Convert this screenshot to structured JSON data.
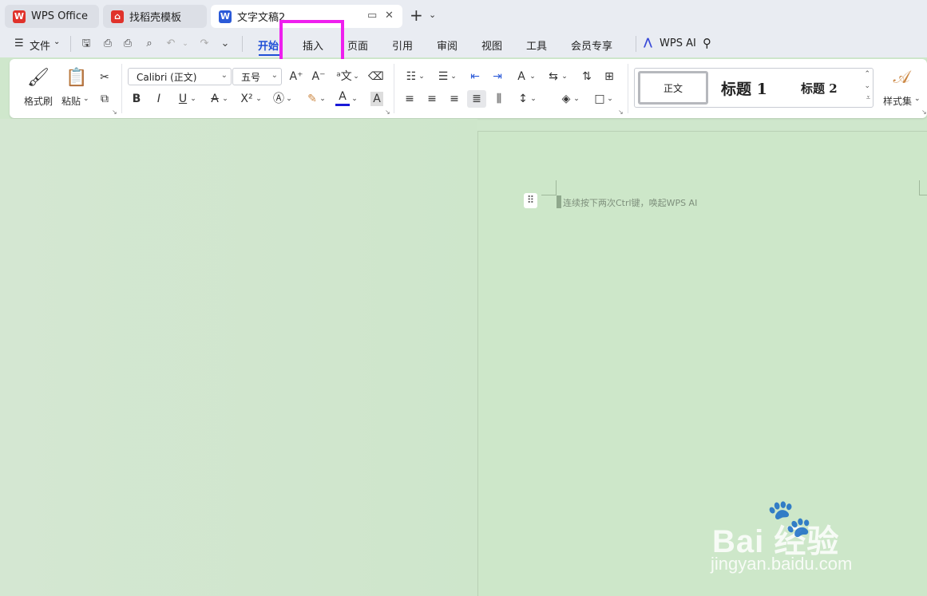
{
  "tabs": [
    {
      "label": "WPS Office",
      "icon": "wps-logo-icon",
      "color": "#e0322b"
    },
    {
      "label": "找稻壳模板",
      "icon": "docer-logo-icon",
      "color": "#e0322b"
    },
    {
      "label": "文字文稿2",
      "icon": "word-doc-icon",
      "color": "#2b5ad8"
    }
  ],
  "menu": {
    "file_label": "文件",
    "items": [
      "开始",
      "插入",
      "页面",
      "引用",
      "审阅",
      "视图",
      "工具",
      "会员专享"
    ],
    "active_index": 0,
    "ai_label": "WPS AI"
  },
  "ribbon": {
    "format_painter": "格式刷",
    "paste": "粘贴",
    "font_name": "Calibri (正文)",
    "font_size": "五号",
    "styles": {
      "normal": "正文",
      "heading1": "标题 1",
      "heading2": "标题 2"
    },
    "style_set": "样式集"
  },
  "document": {
    "ai_hint": "连续按下两次Ctrl键，唤起WPS AI"
  },
  "watermark": {
    "brand": "Bai  经验",
    "url": "jingyan.baidu.com"
  },
  "colors": {
    "accent": "#1f4fd6",
    "highlight": "#ee1fee",
    "page_bg": "#cde7c9"
  }
}
